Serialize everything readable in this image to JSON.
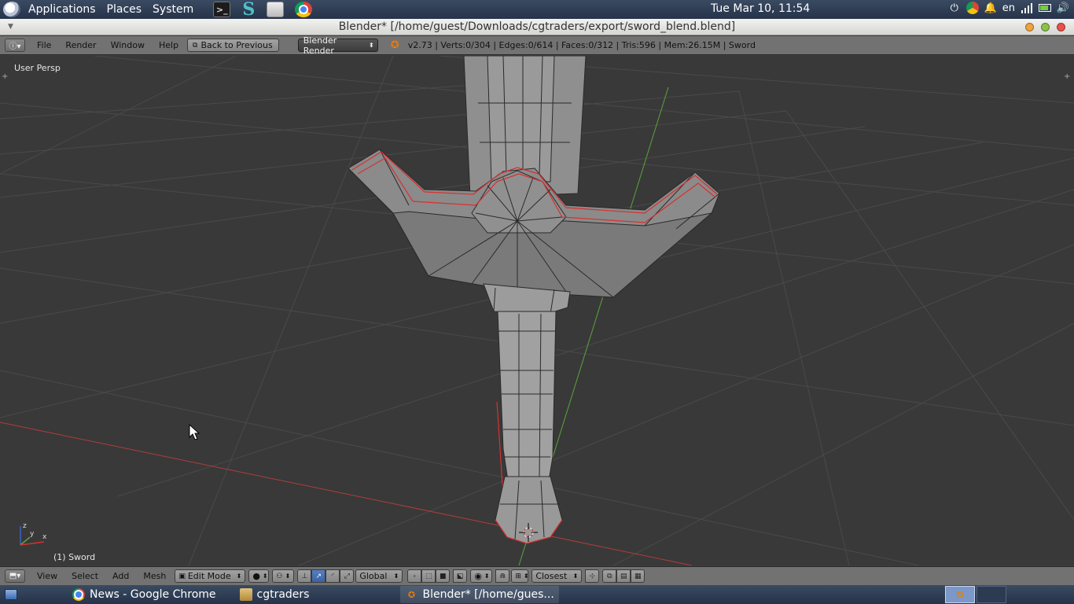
{
  "top_panel": {
    "menus": [
      "Applications",
      "Places",
      "System"
    ],
    "launchers": [
      "terminal-icon",
      "s-app-icon",
      "file-manager-icon",
      "chrome-icon"
    ],
    "clock": "Tue Mar 10, 11:54",
    "keyboard_layout": "en"
  },
  "window": {
    "title": "Blender* [/home/guest/Downloads/cgtraders/export/sword_blend.blend]"
  },
  "info_header": {
    "menus": [
      "File",
      "Render",
      "Window",
      "Help"
    ],
    "back_button": "Back to Previous",
    "render_engine": "Blender Render",
    "stats": "v2.73 | Verts:0/304 | Edges:0/614 | Faces:0/312 | Tris:596 | Mem:26.15M | Sword"
  },
  "viewport": {
    "view_label": "User Persp",
    "object_label": "(1) Sword",
    "axis_labels": {
      "z": "z",
      "y": "y",
      "x": "x"
    }
  },
  "view_header": {
    "menus": [
      "View",
      "Select",
      "Add",
      "Mesh"
    ],
    "mode": "Edit Mode",
    "orientation": "Global",
    "snap_target": "Closest"
  },
  "taskbar": {
    "tasks": [
      {
        "label": "News - Google Chrome",
        "icon": "chrome-icon"
      },
      {
        "label": "cgtraders",
        "icon": "folder-icon"
      },
      {
        "label": "Blender* [/home/gues...",
        "icon": "blender-icon"
      }
    ]
  },
  "colors": {
    "panel": "#2f3d55",
    "viewport_bg": "#393939",
    "grid": "#4a4a4a",
    "x_axis": "#b13c3c",
    "y_axis": "#5aa33b",
    "header": "#727272",
    "mesh": "#8e8e8e",
    "seam_edges": "#d83030"
  }
}
